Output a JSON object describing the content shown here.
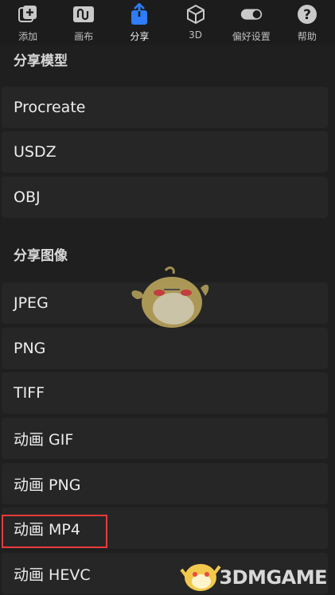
{
  "toolbar": {
    "items": [
      {
        "label": "添加",
        "icon": "add-layer-icon"
      },
      {
        "label": "画布",
        "icon": "canvas-icon"
      },
      {
        "label": "分享",
        "icon": "share-icon",
        "active": true
      },
      {
        "label": "3D",
        "icon": "cube-icon"
      },
      {
        "label": "偏好设置",
        "icon": "toggle-icon"
      },
      {
        "label": "帮助",
        "icon": "help-icon"
      }
    ]
  },
  "share_model": {
    "title": "分享模型",
    "items": [
      "Procreate",
      "USDZ",
      "OBJ"
    ]
  },
  "share_image": {
    "title": "分享图像",
    "items": [
      "JPEG",
      "PNG",
      "TIFF",
      "动画 GIF",
      "动画 PNG",
      "动画 MP4",
      "动画 HEVC"
    ]
  },
  "watermark": {
    "text": "3DMGAME"
  },
  "colors": {
    "accent": "#2f7cf6",
    "highlight": "#e83a3a",
    "background": "#1f1f1f",
    "row": "#262626"
  }
}
